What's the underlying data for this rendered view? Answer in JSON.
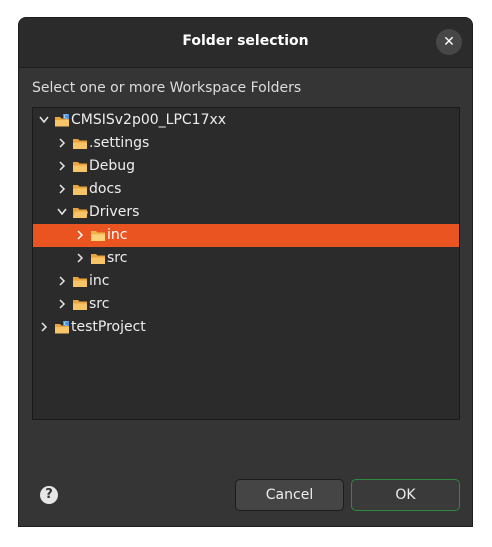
{
  "dialog": {
    "title": "Folder selection",
    "close_icon": "close-icon",
    "prompt": "Select one or more Workspace Folders",
    "accent_color": "#e95420"
  },
  "tree": {
    "items": [
      {
        "label": "CMSISv2p00_LPC17xx",
        "icon": "project-folder-icon",
        "expanded": true
      },
      {
        "label": ".settings",
        "icon": "folder-icon",
        "expanded": false
      },
      {
        "label": "Debug",
        "icon": "folder-icon",
        "expanded": false
      },
      {
        "label": "docs",
        "icon": "folder-icon",
        "expanded": false
      },
      {
        "label": "Drivers",
        "icon": "folder-icon",
        "expanded": true
      },
      {
        "label": "inc",
        "icon": "folder-icon",
        "expanded": false,
        "selected": true
      },
      {
        "label": "src",
        "icon": "folder-icon",
        "expanded": false
      },
      {
        "label": "inc",
        "icon": "folder-icon",
        "expanded": false
      },
      {
        "label": "src",
        "icon": "folder-icon",
        "expanded": false
      },
      {
        "label": "testProject",
        "icon": "project-folder-icon",
        "expanded": false
      }
    ]
  },
  "footer": {
    "help_label": "?",
    "cancel_label": "Cancel",
    "ok_label": "OK"
  }
}
